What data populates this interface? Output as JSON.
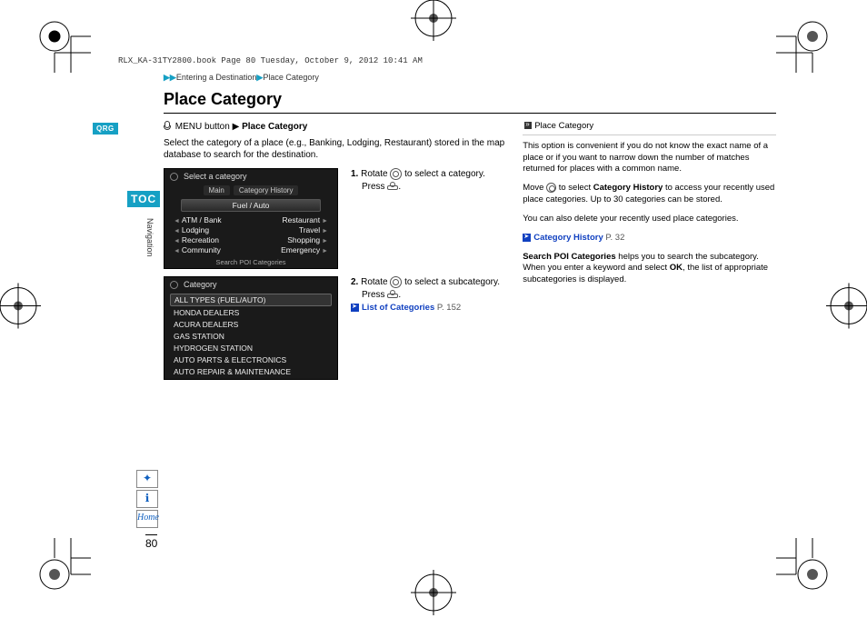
{
  "header_line": "RLX_KA-31TY2800.book  Page 80  Tuesday, October 9, 2012  10:41 AM",
  "left_rail": {
    "qrg": "QRG",
    "toc": "TOC",
    "section": "Navigation",
    "page_number": "80",
    "icons": {
      "voice": "⇡",
      "info": "ℹ",
      "home": "Home"
    }
  },
  "breadcrumb": {
    "a": "Entering a Destination",
    "b": "Place Category"
  },
  "title": "Place Category",
  "menu_line": {
    "prefix": "MENU button",
    "target": "Place Category"
  },
  "intro": "Select the category of a place (e.g., Banking, Lodging, Restaurant) stored in the map database to search for the destination.",
  "screenshot1": {
    "header": "Select a category",
    "tabs": [
      "Main",
      "Category History"
    ],
    "selected": "Fuel / Auto",
    "rows": [
      {
        "l": "ATM / Bank",
        "r": "Restaurant"
      },
      {
        "l": "Lodging",
        "r": "Travel"
      },
      {
        "l": "Recreation",
        "r": "Shopping"
      },
      {
        "l": "Community",
        "r": "Emergency"
      }
    ],
    "footer": "Search POI Categories"
  },
  "step1": {
    "num": "1.",
    "text": "Rotate",
    "text2": "to select a category.",
    "press": "Press"
  },
  "screenshot2": {
    "header": "Category",
    "items": [
      "ALL TYPES (FUEL/AUTO)",
      "HONDA DEALERS",
      "ACURA DEALERS",
      "GAS STATION",
      "HYDROGEN STATION",
      "AUTO PARTS & ELECTRONICS",
      "AUTO REPAIR & MAINTENANCE"
    ]
  },
  "step2": {
    "num": "2.",
    "text": "Rotate",
    "text2": "to select a subcategory.",
    "press": "Press",
    "link_label": "List of Categories",
    "link_page": "P. 152"
  },
  "right": {
    "header": "Place Category",
    "p1": "This option is convenient if you do not know the exact name of a place or if you want to narrow down the number of matches returned for places with a common name.",
    "p2a": "Move",
    "p2b": "to select",
    "p2bold": "Category History",
    "p2c": "to access your recently used place categories. Up to 30 categories can be stored.",
    "p3": "You can also delete your recently used place categories.",
    "link_label": "Category History",
    "link_page": "P. 32",
    "p4a": "Search POI Categories",
    "p4b": "helps you to search the subcategory. When you enter a keyword and select",
    "p4bold": "OK",
    "p4c": ", the list of appropriate subcategories is displayed."
  }
}
